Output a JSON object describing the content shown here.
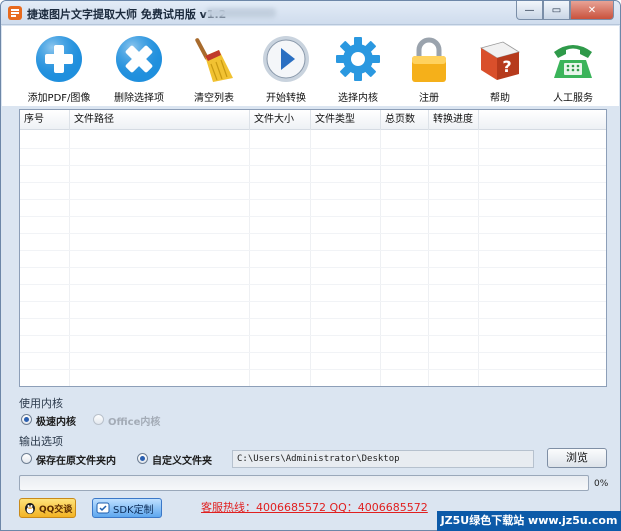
{
  "window": {
    "title": "捷速图片文字提取大师 免费试用版 v1.2",
    "buttons": {
      "minimize": "—",
      "maximize": "▭",
      "close": "✕"
    }
  },
  "toolbar": {
    "items": [
      {
        "label": "添加PDF/图像",
        "icon": "add-icon"
      },
      {
        "label": "删除选择项",
        "icon": "delete-icon"
      },
      {
        "label": "清空列表",
        "icon": "broom-icon"
      },
      {
        "label": "开始转换",
        "icon": "play-icon"
      },
      {
        "label": "选择内核",
        "icon": "gear-icon"
      },
      {
        "label": "注册",
        "icon": "lock-icon"
      },
      {
        "label": "帮助",
        "icon": "help-book-icon"
      },
      {
        "label": "人工服务",
        "icon": "telephone-icon"
      }
    ]
  },
  "table": {
    "columns": [
      "序号",
      "文件路径",
      "文件大小",
      "文件类型",
      "总页数",
      "转换进度"
    ],
    "rows": []
  },
  "engine": {
    "section_label": "使用内核",
    "options": [
      {
        "label": "极速内核",
        "selected": true,
        "enabled": true
      },
      {
        "label": "Office内核",
        "selected": false,
        "enabled": false
      }
    ]
  },
  "output": {
    "section_label": "输出选项",
    "options": [
      {
        "label": "保存在原文件夹内",
        "selected": false
      },
      {
        "label": "自定义文件夹",
        "selected": true
      }
    ],
    "path": "C:\\Users\\Administrator\\Desktop",
    "browse_label": "浏览"
  },
  "progress": {
    "value": 0,
    "text": "0%"
  },
  "footer": {
    "qq_label": "QQ交谈",
    "sdk_label": "SDK定制",
    "hotline": "客服热线：4006685572 QQ：4006685572",
    "watermark": "JZ5U绿色下载站 www.jz5u.com"
  },
  "colors": {
    "frame": "#dbe5f1",
    "accent_blue": "#2a8fdc",
    "hotline_red": "#e02020",
    "progress_green": "#4aa24a"
  }
}
